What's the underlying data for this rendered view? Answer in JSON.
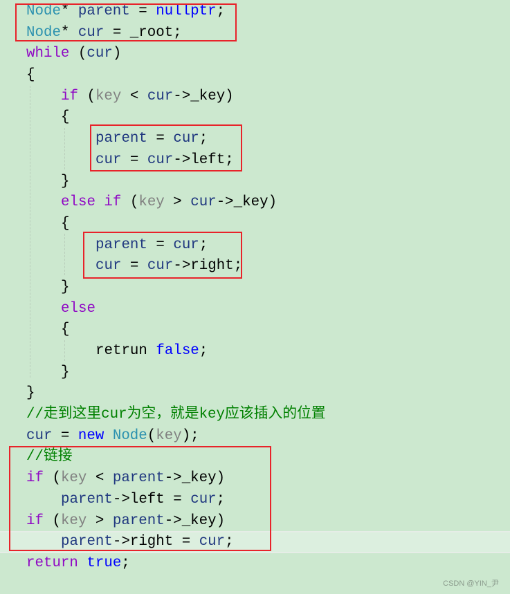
{
  "code_lines": [
    {
      "indent": 0,
      "tokens": [
        [
          "Node",
          "ty"
        ],
        [
          "* ",
          "tx"
        ],
        [
          "parent",
          "va"
        ],
        [
          " = ",
          "tx"
        ],
        [
          "nullptr",
          "bl"
        ],
        [
          ";",
          "tx"
        ]
      ]
    },
    {
      "indent": 0,
      "tokens": [
        [
          "Node",
          "ty"
        ],
        [
          "* ",
          "tx"
        ],
        [
          "cur",
          "va"
        ],
        [
          " = _root;",
          "tx"
        ]
      ]
    },
    {
      "indent": 0,
      "tokens": [
        [
          "while",
          "kw"
        ],
        [
          " (",
          "tx"
        ],
        [
          "cur",
          "va"
        ],
        [
          ")",
          "tx"
        ]
      ]
    },
    {
      "indent": 0,
      "tokens": [
        [
          "{",
          "tx"
        ]
      ]
    },
    {
      "indent": 1,
      "tokens": [
        [
          "if",
          "kw"
        ],
        [
          " (",
          "tx"
        ],
        [
          "key",
          "pa"
        ],
        [
          " < ",
          "tx"
        ],
        [
          "cur",
          "va"
        ],
        [
          "->_key)",
          "tx"
        ]
      ]
    },
    {
      "indent": 1,
      "tokens": [
        [
          "{",
          "tx"
        ]
      ]
    },
    {
      "indent": 2,
      "tokens": [
        [
          "parent",
          "va"
        ],
        [
          " = ",
          "tx"
        ],
        [
          "cur",
          "va"
        ],
        [
          ";",
          "tx"
        ]
      ]
    },
    {
      "indent": 2,
      "tokens": [
        [
          "cur",
          "va"
        ],
        [
          " = ",
          "tx"
        ],
        [
          "cur",
          "va"
        ],
        [
          "->left;",
          "tx"
        ]
      ]
    },
    {
      "indent": 1,
      "tokens": [
        [
          "}",
          "tx"
        ]
      ]
    },
    {
      "indent": 1,
      "tokens": [
        [
          "else if",
          "kw"
        ],
        [
          " (",
          "tx"
        ],
        [
          "key",
          "pa"
        ],
        [
          " > ",
          "tx"
        ],
        [
          "cur",
          "va"
        ],
        [
          "->_key)",
          "tx"
        ]
      ]
    },
    {
      "indent": 1,
      "tokens": [
        [
          "{",
          "tx"
        ]
      ]
    },
    {
      "indent": 2,
      "tokens": [
        [
          "parent",
          "va"
        ],
        [
          " = ",
          "tx"
        ],
        [
          "cur",
          "va"
        ],
        [
          ";",
          "tx"
        ]
      ]
    },
    {
      "indent": 2,
      "tokens": [
        [
          "cur",
          "va"
        ],
        [
          " = ",
          "tx"
        ],
        [
          "cur",
          "va"
        ],
        [
          "->right;",
          "tx"
        ]
      ]
    },
    {
      "indent": 1,
      "tokens": [
        [
          "}",
          "tx"
        ]
      ]
    },
    {
      "indent": 1,
      "tokens": [
        [
          "else",
          "kw"
        ]
      ]
    },
    {
      "indent": 1,
      "tokens": [
        [
          "{",
          "tx"
        ]
      ]
    },
    {
      "indent": 2,
      "tokens": [
        [
          "retrun ",
          "tx"
        ],
        [
          "false",
          "bl"
        ],
        [
          ";",
          "tx"
        ]
      ]
    },
    {
      "indent": 1,
      "tokens": [
        [
          "}",
          "tx"
        ]
      ]
    },
    {
      "indent": 0,
      "tokens": [
        [
          "}",
          "tx"
        ]
      ]
    },
    {
      "indent": 0,
      "tokens": [
        [
          "//走到这里cur为空，就是key应该插入的位置",
          "cm"
        ]
      ]
    },
    {
      "indent": 0,
      "tokens": [
        [
          "cur",
          "va"
        ],
        [
          " = ",
          "tx"
        ],
        [
          "new",
          "bl"
        ],
        [
          " ",
          "tx"
        ],
        [
          "Node",
          "ty"
        ],
        [
          "(",
          "tx"
        ],
        [
          "key",
          "pa"
        ],
        [
          ");",
          "tx"
        ]
      ]
    },
    {
      "indent": 0,
      "tokens": [
        [
          "//链接",
          "cm"
        ]
      ]
    },
    {
      "indent": 0,
      "tokens": [
        [
          "if",
          "kw"
        ],
        [
          " (",
          "tx"
        ],
        [
          "key",
          "pa"
        ],
        [
          " < ",
          "tx"
        ],
        [
          "parent",
          "va"
        ],
        [
          "->_key)",
          "tx"
        ]
      ]
    },
    {
      "indent": 1,
      "tokens": [
        [
          "parent",
          "va"
        ],
        [
          "->left = ",
          "tx"
        ],
        [
          "cur",
          "va"
        ],
        [
          ";",
          "tx"
        ]
      ]
    },
    {
      "indent": 0,
      "tokens": [
        [
          "if",
          "kw"
        ],
        [
          " (",
          "tx"
        ],
        [
          "key",
          "pa"
        ],
        [
          " > ",
          "tx"
        ],
        [
          "parent",
          "va"
        ],
        [
          "->_key)",
          "tx"
        ]
      ]
    },
    {
      "indent": 1,
      "tokens": [
        [
          "parent",
          "va"
        ],
        [
          "->right = ",
          "tx"
        ],
        [
          "cur",
          "va"
        ],
        [
          ";",
          "tx"
        ]
      ]
    },
    {
      "indent": 0,
      "tokens": [
        [
          "return",
          "kw"
        ],
        [
          " ",
          "tx"
        ],
        [
          "true",
          "bl"
        ],
        [
          ";",
          "tx"
        ]
      ]
    }
  ],
  "watermark": "CSDN @YIN_尹",
  "colors": {
    "background": "#cce8cf",
    "highlight_box": "#e8232a",
    "type": "#2b91af",
    "keyword": "#8f08c4",
    "literal": "#0000ff",
    "variable": "#1f377f",
    "parameter": "#808080",
    "comment": "#008000"
  }
}
